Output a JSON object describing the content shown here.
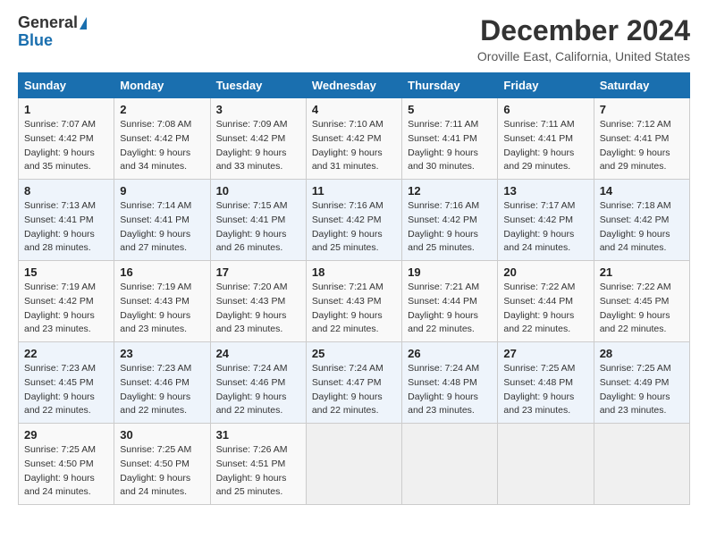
{
  "logo": {
    "general": "General",
    "blue": "Blue"
  },
  "title": "December 2024",
  "subtitle": "Oroville East, California, United States",
  "days_of_week": [
    "Sunday",
    "Monday",
    "Tuesday",
    "Wednesday",
    "Thursday",
    "Friday",
    "Saturday"
  ],
  "weeks": [
    [
      {
        "day": "1",
        "sunrise": "Sunrise: 7:07 AM",
        "sunset": "Sunset: 4:42 PM",
        "daylight": "Daylight: 9 hours and 35 minutes."
      },
      {
        "day": "2",
        "sunrise": "Sunrise: 7:08 AM",
        "sunset": "Sunset: 4:42 PM",
        "daylight": "Daylight: 9 hours and 34 minutes."
      },
      {
        "day": "3",
        "sunrise": "Sunrise: 7:09 AM",
        "sunset": "Sunset: 4:42 PM",
        "daylight": "Daylight: 9 hours and 33 minutes."
      },
      {
        "day": "4",
        "sunrise": "Sunrise: 7:10 AM",
        "sunset": "Sunset: 4:42 PM",
        "daylight": "Daylight: 9 hours and 31 minutes."
      },
      {
        "day": "5",
        "sunrise": "Sunrise: 7:11 AM",
        "sunset": "Sunset: 4:41 PM",
        "daylight": "Daylight: 9 hours and 30 minutes."
      },
      {
        "day": "6",
        "sunrise": "Sunrise: 7:11 AM",
        "sunset": "Sunset: 4:41 PM",
        "daylight": "Daylight: 9 hours and 29 minutes."
      },
      {
        "day": "7",
        "sunrise": "Sunrise: 7:12 AM",
        "sunset": "Sunset: 4:41 PM",
        "daylight": "Daylight: 9 hours and 29 minutes."
      }
    ],
    [
      {
        "day": "8",
        "sunrise": "Sunrise: 7:13 AM",
        "sunset": "Sunset: 4:41 PM",
        "daylight": "Daylight: 9 hours and 28 minutes."
      },
      {
        "day": "9",
        "sunrise": "Sunrise: 7:14 AM",
        "sunset": "Sunset: 4:41 PM",
        "daylight": "Daylight: 9 hours and 27 minutes."
      },
      {
        "day": "10",
        "sunrise": "Sunrise: 7:15 AM",
        "sunset": "Sunset: 4:41 PM",
        "daylight": "Daylight: 9 hours and 26 minutes."
      },
      {
        "day": "11",
        "sunrise": "Sunrise: 7:16 AM",
        "sunset": "Sunset: 4:42 PM",
        "daylight": "Daylight: 9 hours and 25 minutes."
      },
      {
        "day": "12",
        "sunrise": "Sunrise: 7:16 AM",
        "sunset": "Sunset: 4:42 PM",
        "daylight": "Daylight: 9 hours and 25 minutes."
      },
      {
        "day": "13",
        "sunrise": "Sunrise: 7:17 AM",
        "sunset": "Sunset: 4:42 PM",
        "daylight": "Daylight: 9 hours and 24 minutes."
      },
      {
        "day": "14",
        "sunrise": "Sunrise: 7:18 AM",
        "sunset": "Sunset: 4:42 PM",
        "daylight": "Daylight: 9 hours and 24 minutes."
      }
    ],
    [
      {
        "day": "15",
        "sunrise": "Sunrise: 7:19 AM",
        "sunset": "Sunset: 4:42 PM",
        "daylight": "Daylight: 9 hours and 23 minutes."
      },
      {
        "day": "16",
        "sunrise": "Sunrise: 7:19 AM",
        "sunset": "Sunset: 4:43 PM",
        "daylight": "Daylight: 9 hours and 23 minutes."
      },
      {
        "day": "17",
        "sunrise": "Sunrise: 7:20 AM",
        "sunset": "Sunset: 4:43 PM",
        "daylight": "Daylight: 9 hours and 23 minutes."
      },
      {
        "day": "18",
        "sunrise": "Sunrise: 7:21 AM",
        "sunset": "Sunset: 4:43 PM",
        "daylight": "Daylight: 9 hours and 22 minutes."
      },
      {
        "day": "19",
        "sunrise": "Sunrise: 7:21 AM",
        "sunset": "Sunset: 4:44 PM",
        "daylight": "Daylight: 9 hours and 22 minutes."
      },
      {
        "day": "20",
        "sunrise": "Sunrise: 7:22 AM",
        "sunset": "Sunset: 4:44 PM",
        "daylight": "Daylight: 9 hours and 22 minutes."
      },
      {
        "day": "21",
        "sunrise": "Sunrise: 7:22 AM",
        "sunset": "Sunset: 4:45 PM",
        "daylight": "Daylight: 9 hours and 22 minutes."
      }
    ],
    [
      {
        "day": "22",
        "sunrise": "Sunrise: 7:23 AM",
        "sunset": "Sunset: 4:45 PM",
        "daylight": "Daylight: 9 hours and 22 minutes."
      },
      {
        "day": "23",
        "sunrise": "Sunrise: 7:23 AM",
        "sunset": "Sunset: 4:46 PM",
        "daylight": "Daylight: 9 hours and 22 minutes."
      },
      {
        "day": "24",
        "sunrise": "Sunrise: 7:24 AM",
        "sunset": "Sunset: 4:46 PM",
        "daylight": "Daylight: 9 hours and 22 minutes."
      },
      {
        "day": "25",
        "sunrise": "Sunrise: 7:24 AM",
        "sunset": "Sunset: 4:47 PM",
        "daylight": "Daylight: 9 hours and 22 minutes."
      },
      {
        "day": "26",
        "sunrise": "Sunrise: 7:24 AM",
        "sunset": "Sunset: 4:48 PM",
        "daylight": "Daylight: 9 hours and 23 minutes."
      },
      {
        "day": "27",
        "sunrise": "Sunrise: 7:25 AM",
        "sunset": "Sunset: 4:48 PM",
        "daylight": "Daylight: 9 hours and 23 minutes."
      },
      {
        "day": "28",
        "sunrise": "Sunrise: 7:25 AM",
        "sunset": "Sunset: 4:49 PM",
        "daylight": "Daylight: 9 hours and 23 minutes."
      }
    ],
    [
      {
        "day": "29",
        "sunrise": "Sunrise: 7:25 AM",
        "sunset": "Sunset: 4:50 PM",
        "daylight": "Daylight: 9 hours and 24 minutes."
      },
      {
        "day": "30",
        "sunrise": "Sunrise: 7:25 AM",
        "sunset": "Sunset: 4:50 PM",
        "daylight": "Daylight: 9 hours and 24 minutes."
      },
      {
        "day": "31",
        "sunrise": "Sunrise: 7:26 AM",
        "sunset": "Sunset: 4:51 PM",
        "daylight": "Daylight: 9 hours and 25 minutes."
      },
      null,
      null,
      null,
      null
    ]
  ]
}
